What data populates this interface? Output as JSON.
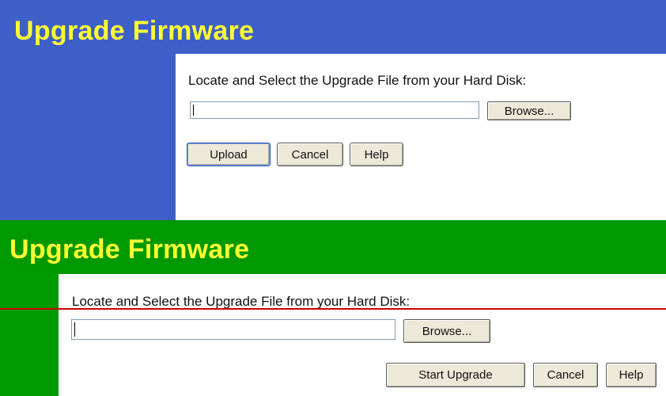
{
  "colors": {
    "top_band": "#3f5fc8",
    "bottom_band": "#009900",
    "title_text": "#ffff33",
    "divider": "#cc0000",
    "button_face": "#ece9d8"
  },
  "top_panel": {
    "title": "Upgrade Firmware",
    "prompt": "Locate and Select the Upgrade File from your Hard Disk:",
    "file_value": "",
    "browse_label": "Browse...",
    "buttons": {
      "upload": "Upload",
      "cancel": "Cancel",
      "help": "Help"
    }
  },
  "bottom_panel": {
    "title": "Upgrade Firmware",
    "prompt": "Locate and Select the Upgrade File from your Hard Disk:",
    "file_value": "",
    "browse_label": "Browse...",
    "buttons": {
      "start_upgrade": "Start Upgrade",
      "cancel": "Cancel",
      "help": "Help"
    }
  }
}
